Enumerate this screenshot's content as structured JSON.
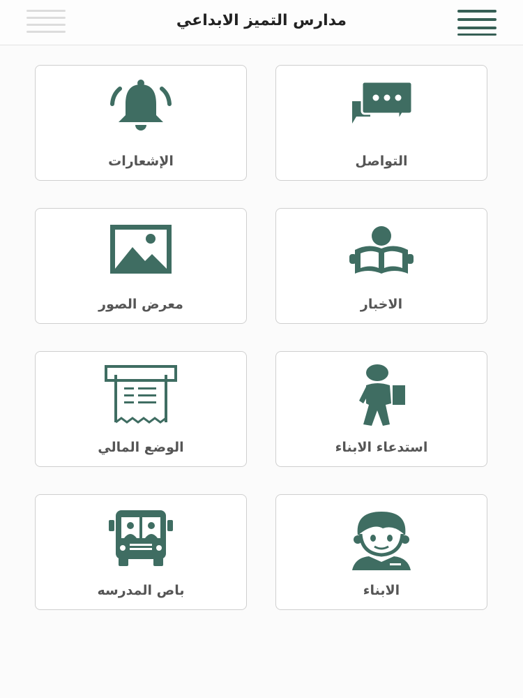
{
  "header": {
    "title": "مدارس التميز الابداعي"
  },
  "colors": {
    "accent": "#3f6d62",
    "menu_active": "#365f55",
    "menu_inactive": "#dcdcdc"
  },
  "tiles": [
    {
      "label": "التواصل",
      "icon": "chat-icon"
    },
    {
      "label": "الإشعارات",
      "icon": "bell-icon"
    },
    {
      "label": "الاخبار",
      "icon": "reader-book-icon"
    },
    {
      "label": "معرض الصور",
      "icon": "image-gallery-icon"
    },
    {
      "label": "استدعاء الابناء",
      "icon": "student-walking-icon"
    },
    {
      "label": "الوضع المالي",
      "icon": "receipt-icon"
    },
    {
      "label": "الابناء",
      "icon": "child-face-icon"
    },
    {
      "label": "باص المدرسه",
      "icon": "school-bus-icon"
    }
  ]
}
